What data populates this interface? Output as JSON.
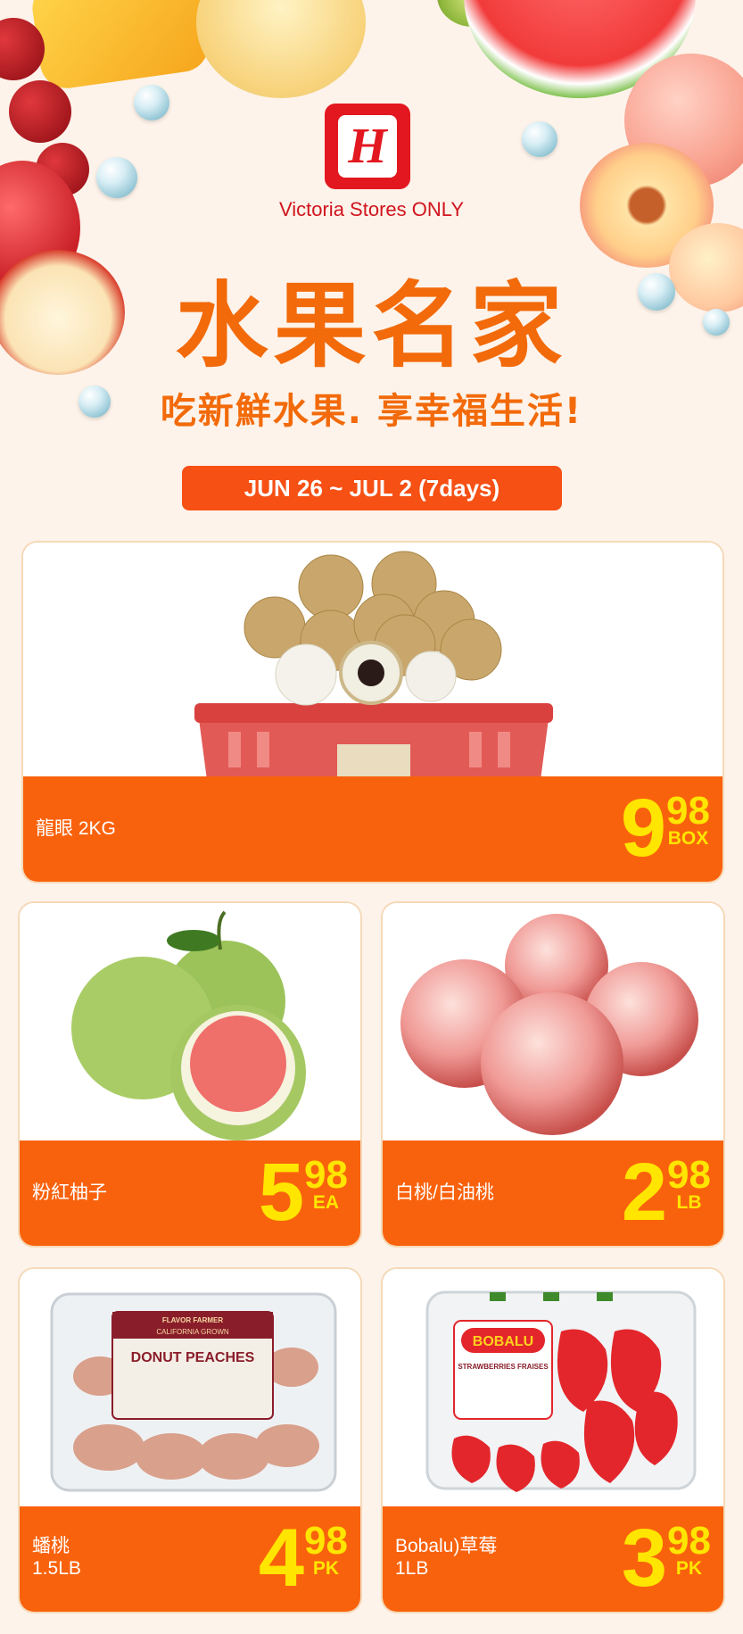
{
  "header": {
    "logo_letter": "H",
    "store_note": "Victoria Stores ONLY",
    "title": "水果名家",
    "subtitle": "吃新鮮水果. 享幸福生活!",
    "dates": "JUN 26 ~ JUL 2 (7days)"
  },
  "colors": {
    "accent_orange": "#f9620c",
    "price_yellow": "#ffe500",
    "brand_red": "#e3171f",
    "title_orange": "#f26a0a"
  },
  "products": [
    {
      "name": "龍眼 2KG",
      "price_dollars": "9",
      "price_cents": "98",
      "unit": "BOX",
      "icon": "longan-basket-icon"
    },
    {
      "name": "粉紅柚子",
      "price_dollars": "5",
      "price_cents": "98",
      "unit": "EA",
      "icon": "pomelo-icon"
    },
    {
      "name": "白桃/白油桃",
      "price_dollars": "2",
      "price_cents": "98",
      "unit": "LB",
      "icon": "peach-icon"
    },
    {
      "name": "蟠桃",
      "name_line2": "1.5LB",
      "price_dollars": "4",
      "price_cents": "98",
      "unit": "PK",
      "icon": "donut-peach-box-icon",
      "package_label": "DONUT PEACHES",
      "package_brand": "FLAVOR FARMER",
      "package_origin": "CALIFORNIA GROWN"
    },
    {
      "name": "Bobalu)草莓",
      "name_line2": "1LB",
      "price_dollars": "3",
      "price_cents": "98",
      "unit": "PK",
      "icon": "strawberry-box-icon",
      "package_label": "BOBALU",
      "package_sub": "STRAWBERRIES FRAISES"
    }
  ]
}
